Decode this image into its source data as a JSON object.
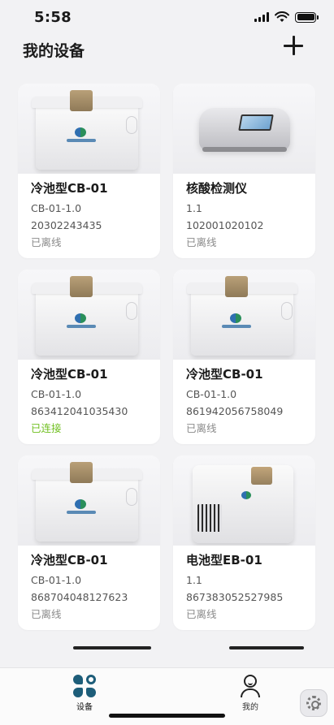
{
  "status_bar": {
    "time": "5:58"
  },
  "header": {
    "title": "我的设备",
    "add_icon": "plus-icon"
  },
  "devices": [
    {
      "name": "冷池型CB-01",
      "model": "CB-01-1.0",
      "serial": "20302243435",
      "status": "已离线",
      "image": "cold-box"
    },
    {
      "name": "核酸检测仪",
      "model": "1.1",
      "serial": "102001020102",
      "status": "已离线",
      "image": "analyzer"
    },
    {
      "name": "冷池型CB-01",
      "model": "CB-01-1.0",
      "serial": "863412041035430",
      "status": "已连接",
      "image": "cold-box"
    },
    {
      "name": "冷池型CB-01",
      "model": "CB-01-1.0",
      "serial": "861942056758049",
      "status": "已离线",
      "image": "cold-box"
    },
    {
      "name": "冷池型CB-01",
      "model": "CB-01-1.0",
      "serial": "868704048127623",
      "status": "已离线",
      "image": "cold-box"
    },
    {
      "name": "电池型EB-01",
      "model": "1.1",
      "serial": "867383052527985",
      "status": "已离线",
      "image": "battery-box"
    }
  ],
  "tab_bar": {
    "devices": {
      "label": "设备",
      "icon": "grid-icon"
    },
    "mine": {
      "label": "我的",
      "icon": "person-icon"
    }
  },
  "colors": {
    "connected": "#6fbf1f",
    "offline": "#8a8a8a",
    "accent": "#1d5d79"
  }
}
